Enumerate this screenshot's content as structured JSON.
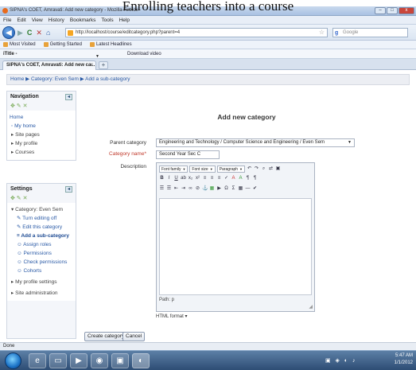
{
  "caption": "Enrolling teachers into a course",
  "window": {
    "title": "SIPNA's COET, Amravati: Add new category - Mozilla Firefox",
    "buttons": [
      "–",
      "□",
      "x"
    ]
  },
  "menu": [
    "File",
    "Edit",
    "View",
    "History",
    "Bookmarks",
    "Tools",
    "Help"
  ],
  "nav": {
    "back": "◀",
    "forward": "▶",
    "reload": "C",
    "stop": "✕",
    "home": "⌂",
    "url": "http://localhost/course/editcategory.php?parent=4",
    "star": "☆",
    "search_engine": "g",
    "search_placeholder": "Google"
  },
  "bookmarks": [
    "Most Visited",
    "Getting Started",
    "Latest Headlines"
  ],
  "addon_bar": {
    "title": "iTitle -",
    "download_label": "Download video"
  },
  "tab": {
    "title": "SIPNA's COET, Amravati: Add new ca...",
    "close": "×",
    "new": "+"
  },
  "breadcrumb": "Home ▶ Category: Even Sem ▶ Add a sub-category",
  "navigation_block": {
    "title": "Navigation",
    "home": "Home",
    "items": [
      "My home",
      "Site pages",
      "My profile",
      "Courses"
    ]
  },
  "settings_block": {
    "title": "Settings",
    "category": "Category: Even Sem",
    "subitems": [
      "Turn editing off",
      "Edit this category",
      "Add a sub-category",
      "Assign roles",
      "Permissions",
      "Check permissions",
      "Cohorts"
    ],
    "items": [
      "My profile settings",
      "Site administration"
    ]
  },
  "form": {
    "heading": "Add new category",
    "parent_label": "Parent category",
    "parent_value": "Engineering and Technology / Computer Science and Engineering / Even Sem",
    "name_label": "Category name*",
    "name_value": "Second Year Sec C",
    "description_label": "Description",
    "font_family": "Font family",
    "font_size": "Font size",
    "paragraph": "Paragraph",
    "path": "Path: p",
    "format": "HTML format ▾",
    "create_button": "Create category",
    "cancel_button": "Cancel"
  },
  "status": "Done",
  "tray": {
    "time": "5:47 AM",
    "date": "1/1/2012"
  }
}
